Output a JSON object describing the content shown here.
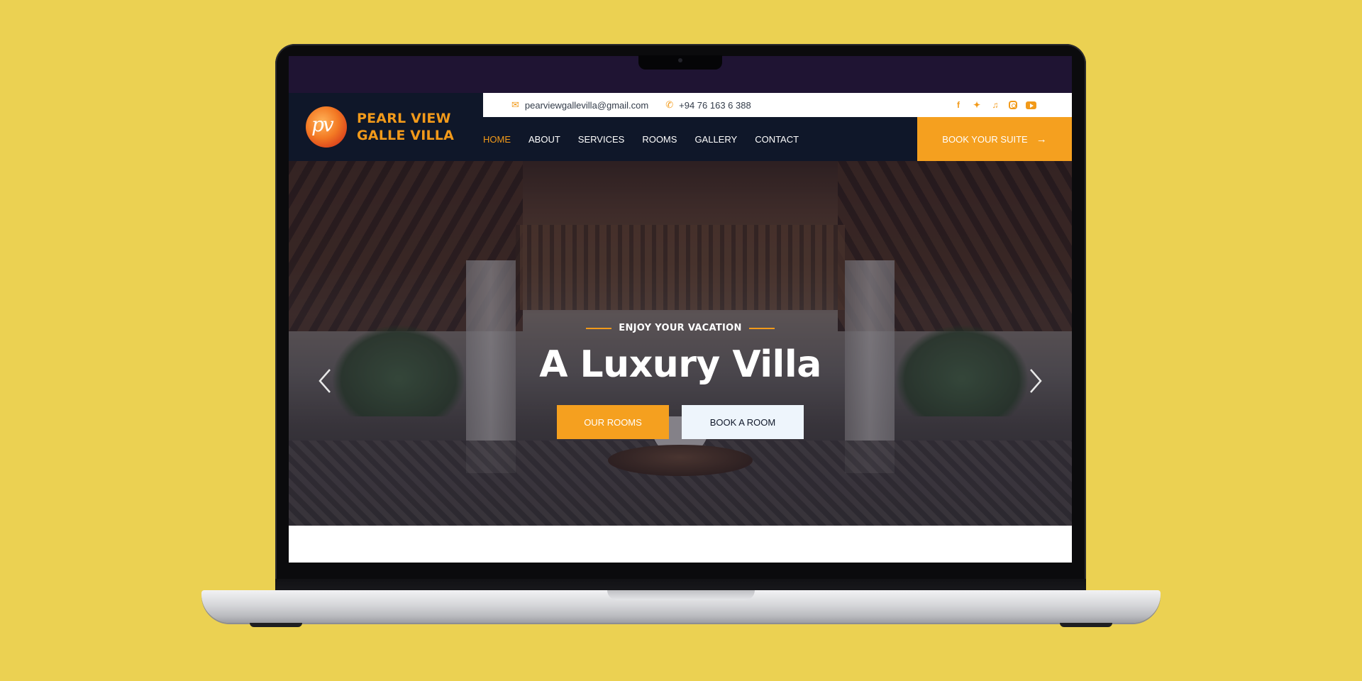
{
  "site": {
    "brand_line1": "PEARL VIEW",
    "brand_line2": "GALLE VILLA",
    "logo_monogram": "pv"
  },
  "topbar": {
    "email": "pearviewgallevilla@gmail.com",
    "phone": "+94 76 163 6 388",
    "email_icon": "envelope-icon",
    "phone_icon": "phone-icon",
    "socials": [
      "facebook-icon",
      "twitter-icon",
      "tiktok-icon",
      "instagram-icon",
      "youtube-icon"
    ]
  },
  "nav": {
    "items": [
      "HOME",
      "ABOUT",
      "SERVICES",
      "ROOMS",
      "GALLERY",
      "CONTACT"
    ],
    "active": "HOME",
    "cta_label": "BOOK YOUR SUITE"
  },
  "hero": {
    "eyebrow": "ENJOY YOUR VACATION",
    "title": "A Luxury Villa",
    "primary_button": "OUR ROOMS",
    "secondary_button": "BOOK A ROOM"
  },
  "colors": {
    "background": "#ebd152",
    "accent": "#f5a01f",
    "header_bg": "#0f1729",
    "top_band": "#1f1433",
    "secondary_button_bg": "#eef5fc"
  }
}
